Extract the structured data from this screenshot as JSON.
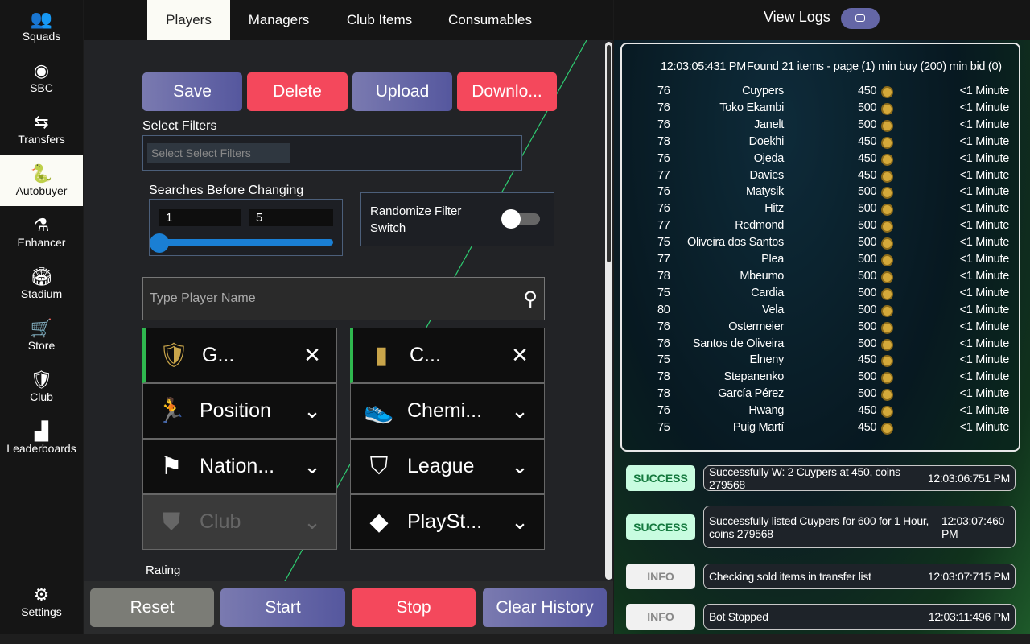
{
  "sidebar": {
    "items": [
      {
        "label": "Squads",
        "icon": "squads-icon",
        "glyph": "👥"
      },
      {
        "label": "SBC",
        "icon": "sbc-icon",
        "glyph": "◉"
      },
      {
        "label": "Transfers",
        "icon": "transfers-icon",
        "glyph": "⇆"
      },
      {
        "label": "Autobuyer",
        "icon": "autobuyer-icon",
        "glyph": "🐍",
        "active": true
      },
      {
        "label": "Enhancer",
        "icon": "flask-icon",
        "glyph": "⚗"
      },
      {
        "label": "Stadium",
        "icon": "stadium-icon",
        "glyph": "🏟"
      },
      {
        "label": "Store",
        "icon": "cart-icon",
        "glyph": "🛒"
      },
      {
        "label": "Club",
        "icon": "club-icon",
        "glyph": "🛡"
      },
      {
        "label": "Leaderboards",
        "icon": "leaderboards-icon",
        "glyph": "▟"
      }
    ],
    "settings": {
      "label": "Settings",
      "icon": "gear-icon",
      "glyph": "⚙"
    }
  },
  "tabs": [
    "Players",
    "Managers",
    "Club Items",
    "Consumables"
  ],
  "actions": {
    "save": "Save",
    "delete": "Delete",
    "upload": "Upload",
    "download": "Downlo..."
  },
  "filters": {
    "label": "Select Filters",
    "placeholder": "Select Select Filters"
  },
  "searches": {
    "label": "Searches Before Changing",
    "min": "1",
    "max": "5",
    "slider_value": 1
  },
  "randomize": {
    "label": "Randomize Filter Switch",
    "on": false
  },
  "player_search": {
    "placeholder": "Type Player Name"
  },
  "filter_cells": [
    {
      "label": "G...",
      "icon": "quality-icon",
      "glyph": "🛡",
      "action": "✕"
    },
    {
      "label": "C...",
      "icon": "card-icon",
      "glyph": "▮",
      "action": "✕"
    },
    {
      "label": "Position",
      "icon": "player-icon",
      "glyph": "🏃",
      "action": "⌄"
    },
    {
      "label": "Chemi...",
      "icon": "boot-icon",
      "glyph": "👟",
      "action": "⌄"
    },
    {
      "label": "Nation...",
      "icon": "flag-icon",
      "glyph": "⚑",
      "action": "⌄"
    },
    {
      "label": "League",
      "icon": "league-icon",
      "glyph": "⛉",
      "action": "⌄"
    },
    {
      "label": "Club",
      "icon": "club-shield-icon",
      "glyph": "⛊",
      "action": "⌄",
      "disabled": true
    },
    {
      "label": "PlaySt...",
      "icon": "playstyle-icon",
      "glyph": "◆",
      "action": "⌄"
    }
  ],
  "rating_label": "Rating",
  "bottom": {
    "reset": "Reset",
    "start": "Start",
    "stop": "Stop",
    "clear": "Clear History"
  },
  "logs": {
    "title": "View Logs",
    "header_time": "12:03:05:431 PM",
    "header_text": "Found 21 items - page (1) min buy (200) min bid (0)",
    "rows": [
      [
        "76",
        "Cuypers",
        "450",
        "<1 Minute"
      ],
      [
        "76",
        "Toko Ekambi",
        "500",
        "<1 Minute"
      ],
      [
        "76",
        "Janelt",
        "500",
        "<1 Minute"
      ],
      [
        "78",
        "Doekhi",
        "450",
        "<1 Minute"
      ],
      [
        "76",
        "Ojeda",
        "450",
        "<1 Minute"
      ],
      [
        "77",
        "Davies",
        "450",
        "<1 Minute"
      ],
      [
        "76",
        "Matysik",
        "500",
        "<1 Minute"
      ],
      [
        "76",
        "Hitz",
        "500",
        "<1 Minute"
      ],
      [
        "77",
        "Redmond",
        "500",
        "<1 Minute"
      ],
      [
        "75",
        "Oliveira dos Santos",
        "500",
        "<1 Minute"
      ],
      [
        "77",
        "Plea",
        "500",
        "<1 Minute"
      ],
      [
        "78",
        "Mbeumo",
        "500",
        "<1 Minute"
      ],
      [
        "75",
        "Cardia",
        "500",
        "<1 Minute"
      ],
      [
        "80",
        "Vela",
        "500",
        "<1 Minute"
      ],
      [
        "76",
        "Ostermeier",
        "500",
        "<1 Minute"
      ],
      [
        "76",
        "Santos de Oliveira",
        "500",
        "<1 Minute"
      ],
      [
        "75",
        "Elneny",
        "450",
        "<1 Minute"
      ],
      [
        "78",
        "Stepanenko",
        "500",
        "<1 Minute"
      ],
      [
        "78",
        "García Pérez",
        "500",
        "<1 Minute"
      ],
      [
        "76",
        "Hwang",
        "450",
        "<1 Minute"
      ],
      [
        "75",
        "Puig Martí",
        "450",
        "<1 Minute"
      ]
    ],
    "entries": [
      {
        "level": "SUCCESS",
        "text": "Successfully W: 2 Cuypers at 450, coins 279568",
        "time": "12:03:06:751 PM"
      },
      {
        "level": "SUCCESS",
        "text": "Successfully listed Cuypers for 600 for 1 Hour, coins 279568",
        "time": "12:03:07:460 PM"
      },
      {
        "level": "INFO",
        "text": "Checking sold items in transfer list",
        "time": "12:03:07:715 PM"
      },
      {
        "level": "INFO",
        "text": "Bot Stopped",
        "time": "12:03:11:496 PM"
      }
    ]
  },
  "colors": {
    "purple": "#6466a6",
    "red": "#f4485c",
    "success_bg": "#c8fce0",
    "accent_blue": "#1a7fd4"
  }
}
